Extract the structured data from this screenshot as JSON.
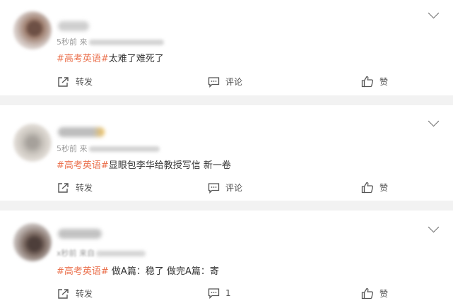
{
  "posts": [
    {
      "time": "5秒前",
      "source_prefix": "来",
      "hashtag": "#高考英语#",
      "text": "太难了难死了",
      "share_label": "转发",
      "comment_label": "评论",
      "like_label": "赞"
    },
    {
      "time": "5秒前",
      "source_prefix": "来",
      "hashtag": "#高考英语#",
      "text": "显眼包李华给教授写信 新一卷",
      "share_label": "转发",
      "comment_label": "评论",
      "like_label": "赞"
    },
    {
      "time": "x秒前",
      "source_prefix": "来自",
      "hashtag": "#高考英语#",
      "text": " 做A篇：稳了 做完A篇：寄",
      "share_label": "转发",
      "comment_label": "1",
      "like_label": "赞"
    }
  ],
  "icons": {
    "share": "share-icon",
    "comment": "comment-icon",
    "like": "thumb-up-icon",
    "menu": "chevron-down-icon"
  },
  "colors": {
    "hashtag": "#eb7350",
    "text": "#333333",
    "meta": "#9a9a9a",
    "background": "#f2f2f2"
  }
}
